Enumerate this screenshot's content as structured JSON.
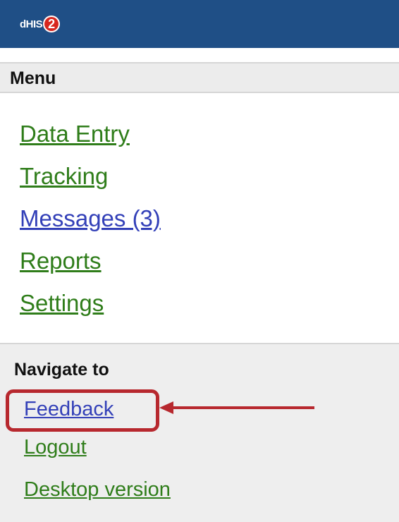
{
  "header": {
    "logo_text": "dHIS",
    "logo_badge": "2"
  },
  "menu": {
    "title": "Menu",
    "items": [
      {
        "label": "Data Entry"
      },
      {
        "label": "Tracking"
      },
      {
        "label": "Messages (3)"
      },
      {
        "label": "Reports"
      },
      {
        "label": "Settings"
      }
    ]
  },
  "navigate": {
    "title": "Navigate to",
    "items": [
      {
        "label": "Feedback"
      },
      {
        "label": "Logout"
      },
      {
        "label": "Desktop version"
      }
    ]
  },
  "colors": {
    "header_bg": "#1f4f86",
    "link_green": "#2f7d1a",
    "link_blue": "#3340b8",
    "highlight": "#b7282e"
  }
}
